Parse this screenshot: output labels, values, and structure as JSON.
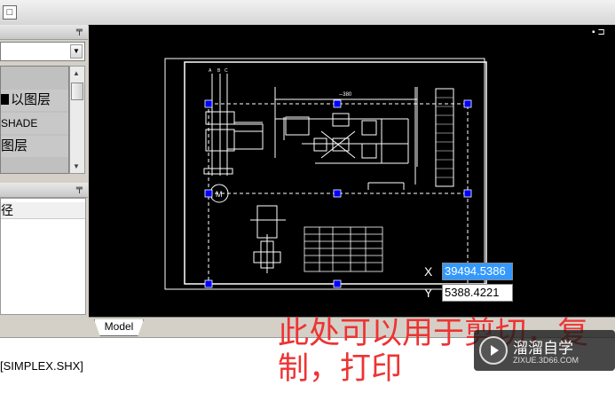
{
  "toolbar": {
    "button_glyph": "□"
  },
  "palette": {
    "list_items": [
      {
        "label": "以图层",
        "swatch_color": "#000000"
      },
      {
        "label": "SHADE"
      },
      {
        "label": "图层"
      }
    ]
  },
  "properties": {
    "row_label": "径"
  },
  "model_tab": {
    "label": "Model"
  },
  "coords": {
    "x_label": "X",
    "x_value": "39494.5386",
    "y_label": "Y",
    "y_value": "5388.4221"
  },
  "status": {
    "text": "[SIMPLEX.SHX]"
  },
  "overlay_note": "此处可以用于剪切，复制，打印",
  "watermark": {
    "title": "溜溜自学",
    "url": "ZIXUE.3D66.COM"
  },
  "colors": {
    "canvas_bg": "#000000",
    "grip": "#0000ff",
    "overlay_text": "#ee3333",
    "selection": "#3399ff"
  }
}
